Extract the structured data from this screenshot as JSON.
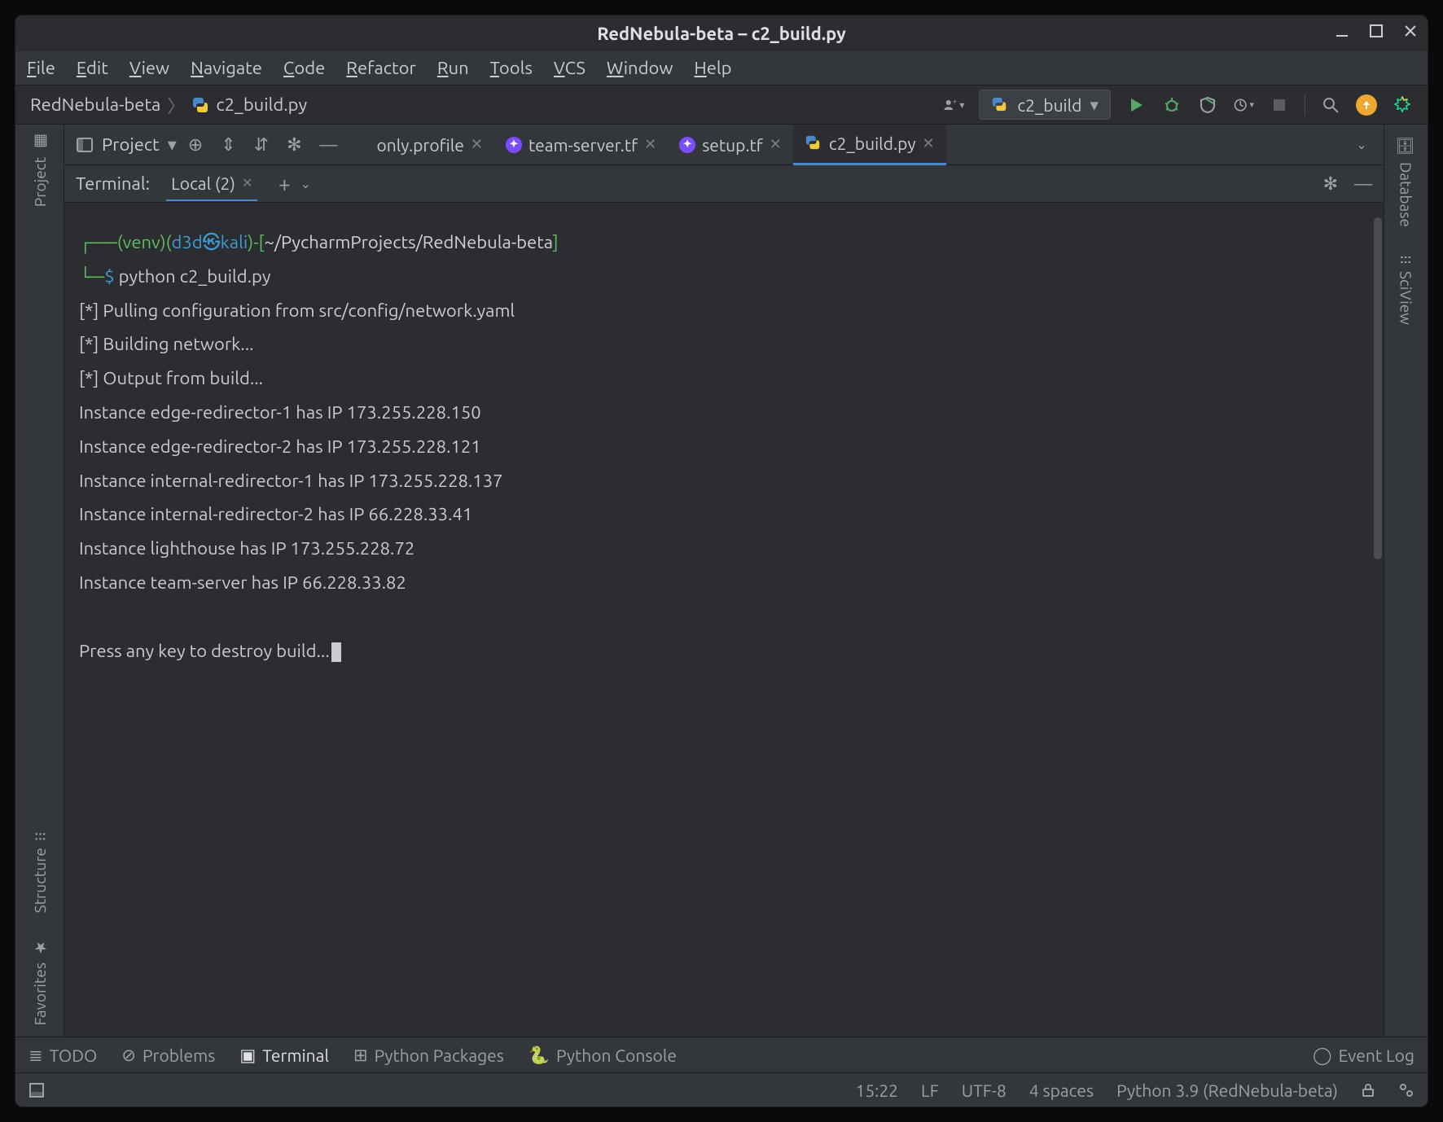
{
  "title": "RedNebula-beta – c2_build.py",
  "menubar": [
    "File",
    "Edit",
    "View",
    "Navigate",
    "Code",
    "Refactor",
    "Run",
    "Tools",
    "VCS",
    "Window",
    "Help"
  ],
  "breadcrumb": {
    "project": "RedNebula-beta",
    "file": "c2_build.py"
  },
  "run_config": "c2_build",
  "project_label": "Project",
  "editor_tabs": [
    {
      "label": "only.profile",
      "kind": "plain",
      "partial": true
    },
    {
      "label": "team-server.tf",
      "kind": "tf"
    },
    {
      "label": "setup.tf",
      "kind": "tf"
    },
    {
      "label": "c2_build.py",
      "kind": "py",
      "active": true
    }
  ],
  "terminal": {
    "header": "Terminal:",
    "tab": "Local (2)",
    "prompt": {
      "venv": "venv",
      "user": "d3d",
      "host": "kali",
      "path": "~/PycharmProjects/RedNebula-beta"
    },
    "command": "python c2_build.py",
    "lines": [
      "[*] Pulling configuration from src/config/network.yaml",
      "[*] Building network...",
      "[*] Output from build...",
      "Instance edge-redirector-1 has IP 173.255.228.150",
      "Instance edge-redirector-2 has IP 173.255.228.121",
      "Instance internal-redirector-1 has IP 173.255.228.137",
      "Instance internal-redirector-2 has IP 66.228.33.41",
      "Instance lighthouse has IP 173.255.228.72",
      "Instance team-server has IP 66.228.33.82"
    ],
    "final": "Press any key to destroy build..."
  },
  "left_tools": [
    "Project",
    "Structure",
    "Favorites"
  ],
  "right_tools": [
    "Database",
    "SciView"
  ],
  "bottom_tools": [
    "TODO",
    "Problems",
    "Terminal",
    "Python Packages",
    "Python Console"
  ],
  "bottom_active": 2,
  "event_log": "Event Log",
  "status": {
    "time": "15:22",
    "le": "LF",
    "enc": "UTF-8",
    "indent": "4 spaces",
    "interp": "Python 3.9 (RedNebula-beta)"
  }
}
